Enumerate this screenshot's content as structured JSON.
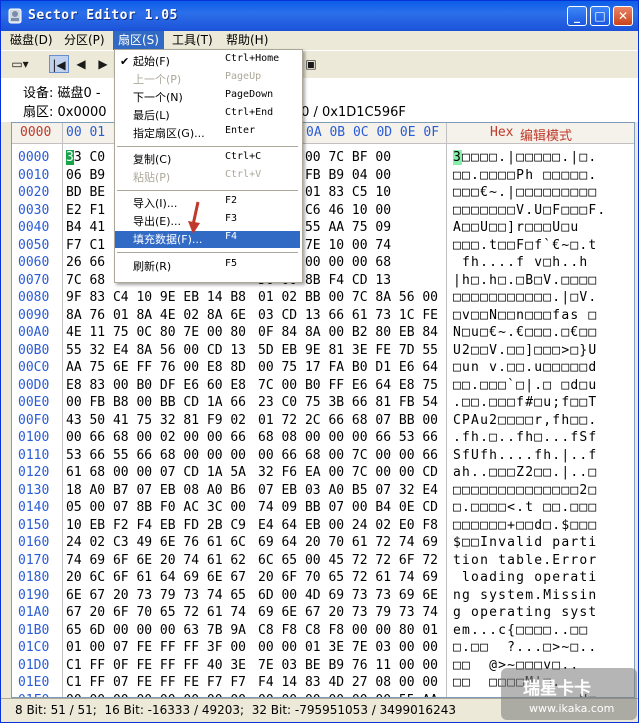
{
  "window": {
    "title": "Sector Editor 1.05"
  },
  "menubar": [
    {
      "label": "磁盘(D)"
    },
    {
      "label": "分区(P)"
    },
    {
      "label": "扇区(S)"
    },
    {
      "label": "工具(T)"
    },
    {
      "label": "帮助(H)"
    }
  ],
  "info": {
    "line1": "设备: 磁盘0 -                       (232.9 GB)",
    "line2": "扇区: 0x0000                        区: 0x00000000 / 0x1D1C596F"
  },
  "hex_header": {
    "offset": "0000",
    "cols1": "00 01",
    "cols2": "0A 0B 0C 0D 0E 0F",
    "hex_label": "Hex",
    "mode_label": "编辑模式"
  },
  "rows": [
    {
      "off": "0000",
      "h1": "33 C0",
      "h2": "D8 BE 00 7C BF 00",
      "asc": "3□□□□.|□□□□□.|□."
    },
    {
      "off": "0010",
      "h1": "06 B9",
      "h2": "06 CB FB B9 04 00",
      "asc": "□□.□□□□Ph □□□□□."
    },
    {
      "off": "0020",
      "h1": "BD BE",
      "h2": "85 0E 01 83 C5 10",
      "asc": "□□□€~.|□□□□□□□□□"
    },
    {
      "off": "0030",
      "h1": "E2 F1",
      "h2": "11 05 C6 46 10 00",
      "asc": "□□□□□□□V.U□F□□□F."
    },
    {
      "off": "0040",
      "h1": "B4 41",
      "h2": "81 FB 55 AA 75 09",
      "asc": "A□□U□□]r□□□U□u"
    },
    {
      "off": "0050",
      "h1": "F7 C1",
      "h2": "60 80 7E 10 00 74",
      "asc": "□□□.t□□F□f`€~□.t"
    },
    {
      "off": "0060",
      "h1": "26 66",
      "h2": "68 00 00 00 00 68",
      "asc": " fh....f v□h..h"
    },
    {
      "off": "0070",
      "h1": "7C 68",
      "h2": "56 00 8B F4 CD 13",
      "asc": "|h□.h□.□B□V.□□□□"
    },
    {
      "off": "0080",
      "h1": "9F 83 C4 10 9E EB 14 B8",
      "h2": "01 02 BB 00 7C 8A 56 00",
      "asc": "□□□□□□□□□□□.|□V."
    },
    {
      "off": "0090",
      "h1": "8A 76 01 8A 4E 02 8A 6E",
      "h2": "03 CD 13 66 61 73 1C FE",
      "asc": "□v□□N□□n□□□fas □"
    },
    {
      "off": "00A0",
      "h1": "4E 11 75 0C 80 7E 00 80",
      "h2": "0F 84 8A 00 B2 80 EB 84",
      "asc": "N□u□€~.€□□□.□€□□"
    },
    {
      "off": "00B0",
      "h1": "55 32 E4 8A 56 00 CD 13",
      "h2": "5D EB 9E 81 3E FE 7D 55",
      "asc": "U2□□V.□□]□□□>□}U"
    },
    {
      "off": "00C0",
      "h1": "AA 75 6E FF 76 00 E8 8D",
      "h2": "00 75 17 FA B0 D1 E6 64",
      "asc": "□un v.□□.u□□□□□d"
    },
    {
      "off": "00D0",
      "h1": "E8 83 00 B0 DF E6 60 E8",
      "h2": "7C 00 B0 FF E6 64 E8 75",
      "asc": "□□.□□□`□|.□ □d□u"
    },
    {
      "off": "00E0",
      "h1": "00 FB B8 00 BB CD 1A 66",
      "h2": "23 C0 75 3B 66 81 FB 54",
      "asc": ".□□.□□□f#□u;f□□T"
    },
    {
      "off": "00F0",
      "h1": "43 50 41 75 32 81 F9 02",
      "h2": "01 72 2C 66 68 07 BB 00",
      "asc": "CPAu2□□□□r,fh□□."
    },
    {
      "off": "0100",
      "h1": "00 66 68 00 02 00 00 66",
      "h2": "68 08 00 00 00 66 53 66",
      "asc": ".fh.□..fh□...fSf"
    },
    {
      "off": "0110",
      "h1": "53 66 55 66 68 00 00 00",
      "h2": "00 66 68 00 7C 00 00 66",
      "asc": "SfUfh....fh.|..f"
    },
    {
      "off": "0120",
      "h1": "61 68 00 00 07 CD 1A 5A",
      "h2": "32 F6 EA 00 7C 00 00 CD",
      "asc": "ah..□□□Z2□□.|..□"
    },
    {
      "off": "0130",
      "h1": "18 A0 B7 07 EB 08 A0 B6",
      "h2": "07 EB 03 A0 B5 07 32 E4",
      "asc": "□□□□□□□□□□□□□□2□"
    },
    {
      "off": "0140",
      "h1": "05 00 07 8B F0 AC 3C 00",
      "h2": "74 09 BB 07 00 B4 0E CD",
      "asc": "□.□□□□<.t □□.□□□"
    },
    {
      "off": "0150",
      "h1": "10 EB F2 F4 EB FD 2B C9",
      "h2": "E4 64 EB 00 24 02 E0 F8",
      "asc": "□□□□□□+□□d□.$□□□"
    },
    {
      "off": "0160",
      "h1": "24 02 C3 49 6E 76 61 6C",
      "h2": "69 64 20 70 61 72 74 69",
      "asc": "$□□Invalid parti"
    },
    {
      "off": "0170",
      "h1": "74 69 6F 6E 20 74 61 62",
      "h2": "6C 65 00 45 72 72 6F 72",
      "asc": "tion table.Error"
    },
    {
      "off": "0180",
      "h1": "20 6C 6F 61 64 69 6E 67",
      "h2": "20 6F 70 65 72 61 74 69",
      "asc": " loading operati"
    },
    {
      "off": "0190",
      "h1": "6E 67 20 73 79 73 74 65",
      "h2": "6D 00 4D 69 73 73 69 6E",
      "asc": "ng system.Missin"
    },
    {
      "off": "01A0",
      "h1": "67 20 6F 70 65 72 61 74",
      "h2": "69 6E 67 20 73 79 73 74",
      "asc": "g operating syst"
    },
    {
      "off": "01B0",
      "h1": "65 6D 00 00 00 63 7B 9A",
      "h2": "C8 F8 C8 F8 00 00 80 01",
      "asc": "em...c{□□□□..□□"
    },
    {
      "off": "01C0",
      "h1": "01 00 07 FE FF FF 3F 00",
      "h2": "00 00 01 3E 7E 03 00 00",
      "asc": "□.□□  ?...□>~□.."
    },
    {
      "off": "01D0",
      "h1": "C1 FF 0F FE FF FF 40 3E",
      "h2": "7E 03 BE B9 76 11 00 00",
      "asc": "□□  @>~□□□v□.."
    },
    {
      "off": "01E0",
      "h1": "C1 FF 07 FE FF FE F7 F7",
      "h2": "F4 14 83 4D 27 08 00 00",
      "asc": "□□  □□□□M'□.."
    },
    {
      "off": "01F0",
      "h1": "00 00 00 00 00 00 00 00",
      "h2": "00 00 00 00 00 00 55 AA",
      "asc": "..............U□"
    }
  ],
  "status": {
    "text": "8 Bit: 51 / 51;  16 Bit: -16333 / 49203;  32 Bit: -795951053 / 3499016243"
  },
  "dropdown": [
    {
      "label": "起始(F)",
      "shortcut": "Ctrl+Home",
      "checked": "✔",
      "state": "normal"
    },
    {
      "label": "上一个(P)",
      "shortcut": "PageUp",
      "checked": "",
      "state": "disabled"
    },
    {
      "label": "下一个(N)",
      "shortcut": "PageDown",
      "checked": "",
      "state": "normal"
    },
    {
      "label": "最后(L)",
      "shortcut": "Ctrl+End",
      "checked": "",
      "state": "normal"
    },
    {
      "label": "指定扇区(G)...",
      "shortcut": "Enter",
      "checked": "",
      "state": "normal"
    },
    {
      "label": "复制(C)",
      "shortcut": "Ctrl+C",
      "checked": "",
      "state": "normal"
    },
    {
      "label": "粘贴(P)",
      "shortcut": "Ctrl+V",
      "checked": "",
      "state": "disabled"
    },
    {
      "label": "导入(I)...",
      "shortcut": "F2",
      "checked": "",
      "state": "normal"
    },
    {
      "label": "导出(E)...",
      "shortcut": "F3",
      "checked": "",
      "state": "normal"
    },
    {
      "label": "填充数据(F)...",
      "shortcut": "F4",
      "checked": "",
      "state": "highlighted"
    },
    {
      "label": "刷新(R)",
      "shortcut": "F5",
      "checked": "",
      "state": "normal"
    }
  ],
  "watermark": {
    "text": "瑞星卡卡",
    "url": "www.ikaka.com"
  },
  "colors": {
    "title_bar": "#1b52d8",
    "highlight": "#316ac5",
    "offset_text": "#2a5bd7",
    "mode_label": "#c0392b",
    "arrow": "#c0392b"
  }
}
